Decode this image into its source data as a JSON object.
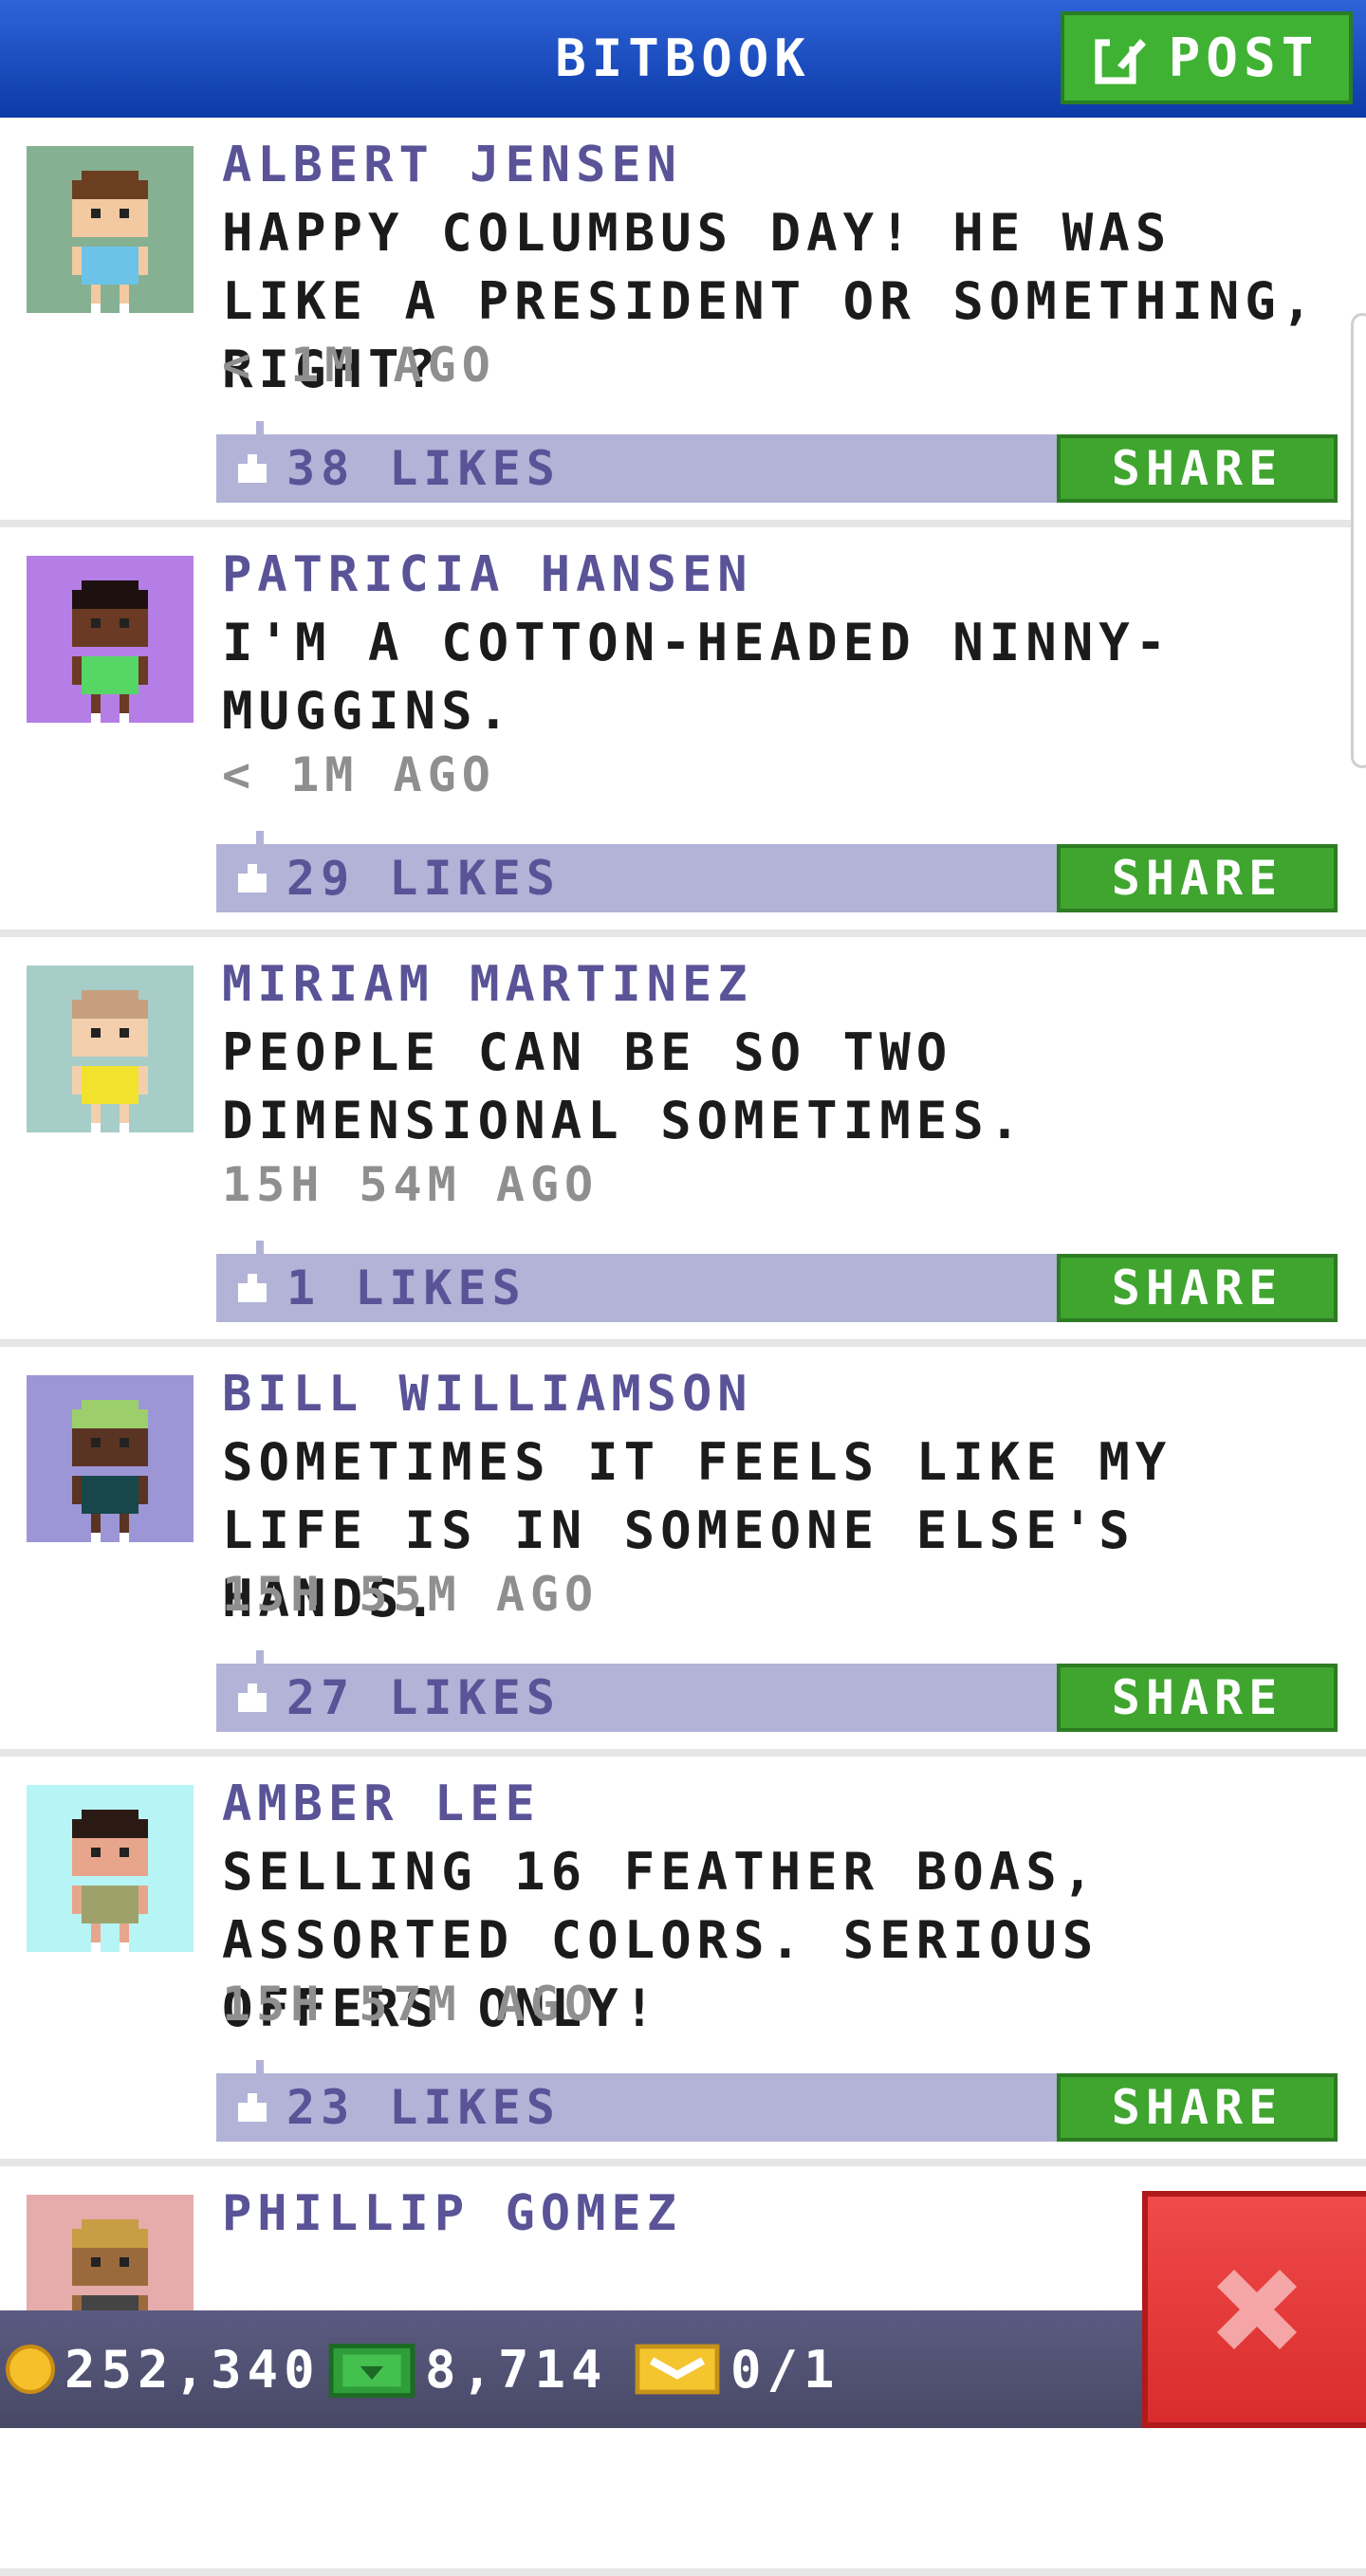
{
  "header": {
    "title": "BITBOOK",
    "post_label": "POST"
  },
  "posts": [
    {
      "author": "ALBERT JENSEN",
      "message": "HAPPY COLUMBUS DAY! HE WAS LIKE A PRESIDENT OR SOMETHING, RIGHT?",
      "time": "< 1M AGO",
      "likes": "38 LIKES",
      "share": "SHARE",
      "avatar_bg": "#86b092",
      "skin": "#f2c9a0",
      "hair": "#6b3e22",
      "shirt": "#6cc3e8"
    },
    {
      "author": "PATRICIA HANSEN",
      "message": "I'M A COTTON-HEADED NINNY-MUGGINS.",
      "time": "< 1M AGO",
      "likes": "29 LIKES",
      "share": "SHARE",
      "avatar_bg": "#b57ee6",
      "skin": "#6b3a24",
      "hair": "#1d1110",
      "shirt": "#56d664"
    },
    {
      "author": "MIRIAM MARTINEZ",
      "message": "PEOPLE CAN BE SO TWO DIMENSIONAL SOMETIMES.",
      "time": "15H 54M AGO",
      "likes": "1 LIKES",
      "share": "SHARE",
      "avatar_bg": "#a7cdc8",
      "skin": "#f3cfae",
      "hair": "#c6a07e",
      "shirt": "#f2e22e"
    },
    {
      "author": "BILL WILLIAMSON",
      "message": "SOMETIMES IT FEELS LIKE MY LIFE IS IN SOMEONE ELSE'S HANDS.",
      "time": "15H 55M AGO",
      "likes": "27 LIKES",
      "share": "SHARE",
      "avatar_bg": "#9d96d6",
      "skin": "#5a3422",
      "hair": "#9ccf6c",
      "shirt": "#17474a"
    },
    {
      "author": "AMBER LEE",
      "message": "SELLING 16 FEATHER BOAS, ASSORTED COLORS. SERIOUS OFFERS ONLY!",
      "time": "15H 57M AGO",
      "likes": "23 LIKES",
      "share": "SHARE",
      "avatar_bg": "#b7f4f6",
      "skin": "#e7a58c",
      "hair": "#2b1a14",
      "shirt": "#9ea26a"
    },
    {
      "author": "PHILLIP GOMEZ",
      "message": "",
      "time": "",
      "likes": "",
      "share": "",
      "avatar_bg": "#e6abab",
      "skin": "#9a6a3c",
      "hair": "#c79e43",
      "shirt": "#444444"
    }
  ],
  "bottom": {
    "coins": "252,340",
    "bux": "8,714",
    "tickets": "0/1"
  },
  "colors": {
    "header": "#1a4bc0",
    "green": "#3fa52f",
    "like_bar": "#b2b3d7",
    "author": "#5a5397",
    "close": "#e23838"
  },
  "icons": [
    "edit-icon",
    "like-icon",
    "coin-icon",
    "bux-icon",
    "ticket-icon",
    "close-icon"
  ]
}
